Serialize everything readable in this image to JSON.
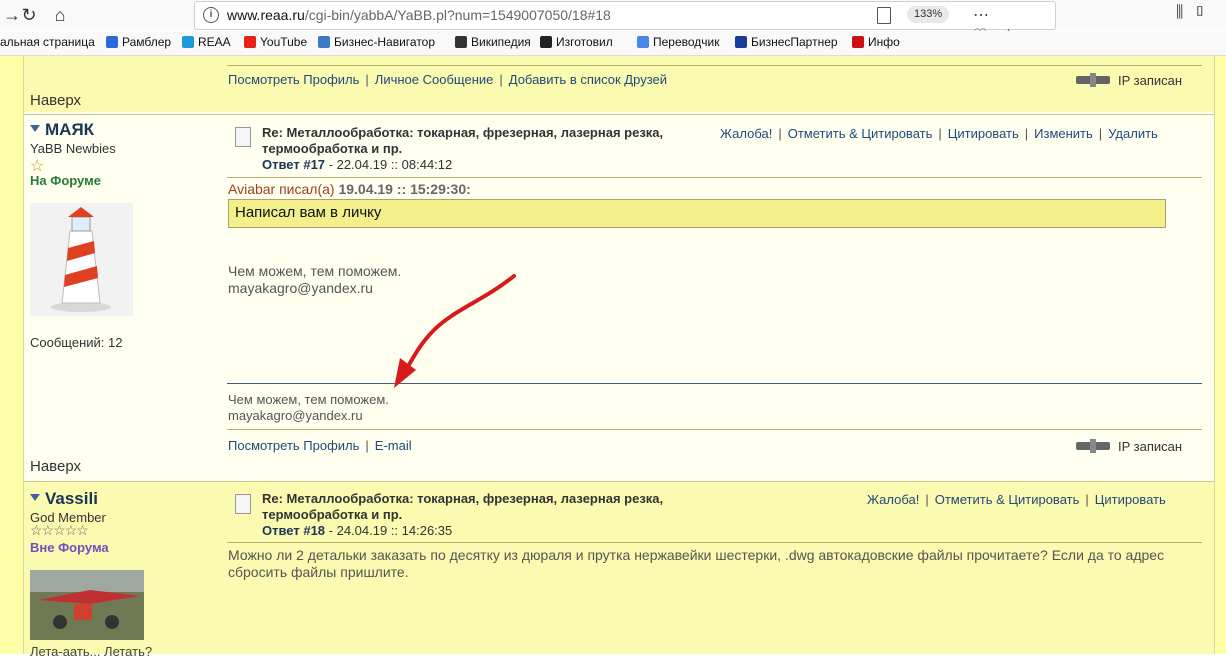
{
  "browser": {
    "url_host": "www.reaa.ru",
    "url_path": "/cgi-bin/yabbA/YaBB.pl?num=1549007050/18#18",
    "zoom": "133%",
    "bookmarks": [
      "альная страница",
      "Рамблер",
      "REAA",
      "YouTube",
      "Бизнес-Навигатор",
      "Википедия",
      "Изготовил",
      "Переводчик",
      "БизнесПартнер",
      "Инфо"
    ],
    "bookmark_colors": [
      "#2a6bd8",
      "#2a6bd8",
      "#1a9ad8",
      "#e62117",
      "#3a7ac8",
      "#333333",
      "#222222",
      "#4a86e8",
      "#1a3a9a",
      "#cc1111"
    ]
  },
  "prev_post": {
    "links": [
      "Посмотреть Профиль",
      "Личное Сообщение",
      "Добавить в список Друзей"
    ],
    "ip": "IP записан",
    "top": "Наверх"
  },
  "post17": {
    "author": "МАЯК",
    "rank": "YaBB Newbies",
    "status": "На Форуме",
    "messages": "Сообщений: 12",
    "subject": "Re: Металлообработка: токарная, фрезерная, лазерная резка, термообработка и пр.",
    "reply_no": "Ответ #17",
    "date": "- 22.04.19 :: 08:44:12",
    "actions": [
      "Жалоба!",
      "Отметить & Цитировать",
      "Цитировать",
      "Изменить",
      "Удалить"
    ],
    "quote_author": "Aviabar писал(а)",
    "quote_date": "19.04.19 :: 15:29:30:",
    "quote_text": "Написал вам в личку",
    "body_line1": "Чем можем, тем поможем.",
    "body_line2": "mayakagro@yandex.ru",
    "sig_line1": "Чем можем, тем поможем.",
    "sig_line2": "mayakagro@yandex.ru",
    "links": [
      "Посмотреть Профиль",
      "E-mail"
    ],
    "ip": "IP записан",
    "top": "Наверх"
  },
  "post18": {
    "author": "Vassili",
    "rank": "God Member",
    "status": "Вне Форума",
    "subject": "Re: Металлообработка: токарная, фрезерная, лазерная резка, термообработка и пр.",
    "reply_no": "Ответ #18",
    "date": "- 24.04.19 :: 14:26:35",
    "actions": [
      "Жалоба!",
      "Отметить & Цитировать",
      "Цитировать"
    ],
    "body": "Можно ли 2 детальки заказать по десятку из дюраля и прутка нержавейки шестерки, .dwg автокадовские файлы прочитаете? Если да то адрес сбросить файлы пришлите.",
    "motto": "Лета-аать... Летать?"
  }
}
